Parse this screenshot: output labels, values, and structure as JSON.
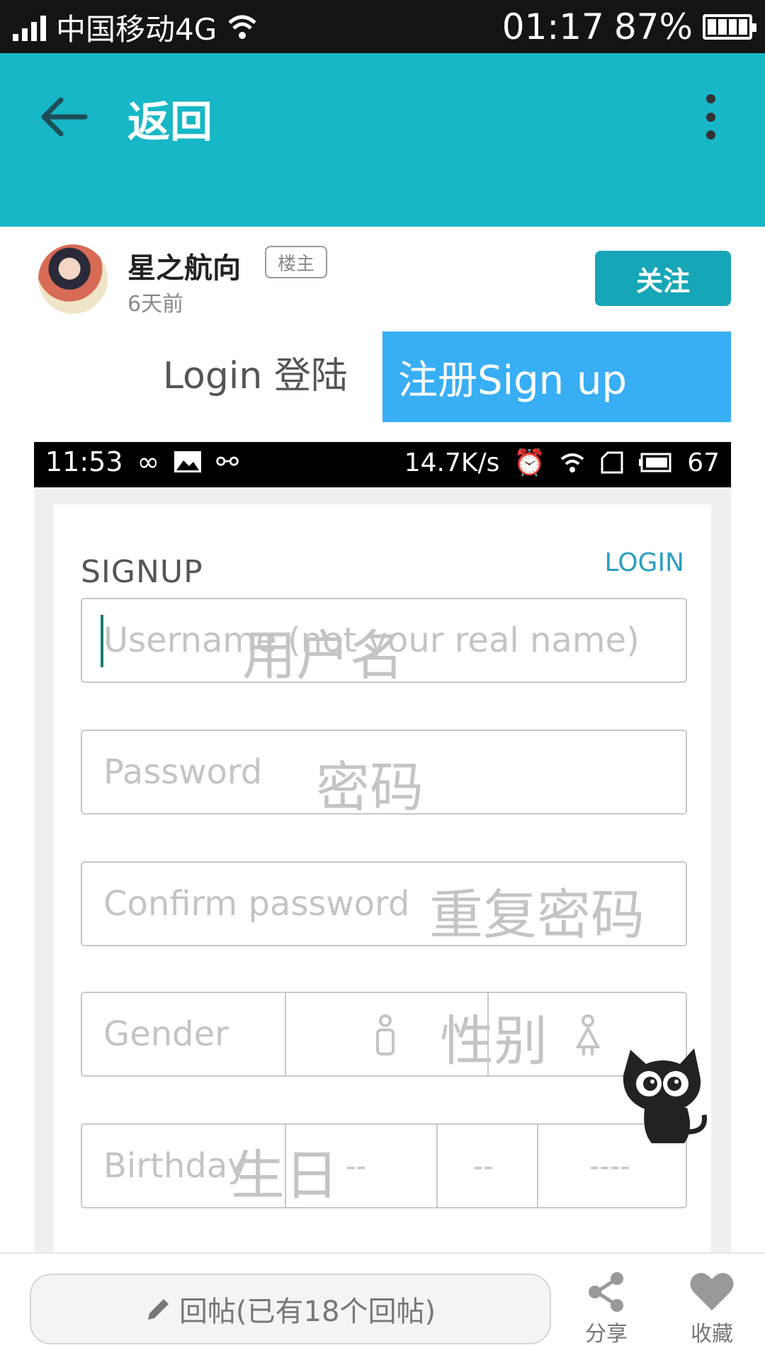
{
  "status_bar": {
    "carrier": "中国移动4G",
    "time": "01:17",
    "battery": "87%"
  },
  "app_bar": {
    "back_label": "返回"
  },
  "post": {
    "author": "星之航向",
    "badge": "楼主",
    "time": "6天前",
    "follow_label": "关注",
    "login_label": "Login 登陆",
    "signup_label": "注册Sign up"
  },
  "screenshot": {
    "status_time": "11:53",
    "status_speed": "14.7K/s",
    "status_battery": "67",
    "title": "SIGNUP",
    "login_link": "LOGIN",
    "username_placeholder": "Username (not your real name)",
    "username_cn": "用户名",
    "password_placeholder": "Password",
    "password_cn": "密码",
    "confirm_placeholder": "Confirm password",
    "confirm_cn": "重复密码",
    "gender_label": "Gender",
    "gender_cn": "性别",
    "birthday_label": "Birthday",
    "birthday_cn": "生日",
    "birthday_day": "--",
    "birthday_month": "--",
    "birthday_year": "----"
  },
  "bottom_bar": {
    "reply_label": "回帖(已有18个回帖)",
    "share_label": "分享",
    "favorite_label": "收藏"
  },
  "colors": {
    "appbar": "#17b7c7",
    "follow": "#17a6b7",
    "signup_box": "#38aef5"
  }
}
